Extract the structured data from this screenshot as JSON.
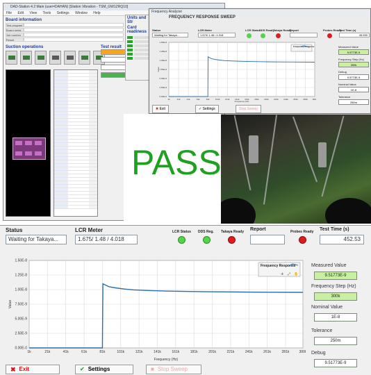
{
  "top": {
    "main_window_title": "DAD-Station 4.2 Main (user=DAHAN) [Station Vibration - TSM_GW1ZRQ10]",
    "menu": [
      "File",
      "Edit",
      "View",
      "Tools",
      "Settings",
      "Window",
      "Help"
    ],
    "board_info_title": "Board information",
    "board_info_rows": [
      {
        "key": "Test program",
        "value": ""
      },
      {
        "key": "Board serial",
        "value": ""
      },
      {
        "key": "Job number",
        "value": ""
      },
      {
        "key": "Result",
        "value": ""
      }
    ],
    "suction_title": "Suction operations",
    "right_strip_title": "Units and Str",
    "right_strip_sub": "Card readiness",
    "test_result_title": "Test result",
    "inset_window_title": "Frequency Analyzer",
    "inset_heading": "FREQUENCY RESPONSE SWEEP",
    "inset": {
      "status_label": "Status",
      "status_value": "Waiting for Takaya...",
      "lcr_label": "LCR Meter",
      "lcr_value": "1.670/ 1.48 / 4.018",
      "leds": [
        "LCR Status",
        "DDS Ready",
        "Takaya Ready"
      ],
      "report_label": "Report",
      "probes_label": "Probes Ready",
      "test_time_label": "Test Time (s)",
      "test_time_value": "45.530",
      "measured_label": "Measured Value",
      "measured_value": "9.5773E-9",
      "freq_step_label": "Frequency Step (Hz)",
      "freq_step_value": "300k",
      "debug_label": "Debug",
      "debug_value": "9.5773E-9",
      "nominal_label": "Nominal Value",
      "nominal_value": "1E-8",
      "tolerance_label": "Tolerance",
      "tolerance_value": "250m",
      "buttons": [
        "Exit",
        "Settings",
        "Stop Sweep"
      ]
    },
    "pass_text": "PASS"
  },
  "freq_app": {
    "status_label": "Status",
    "status_value": "Waiting for Takaya...",
    "lcr_label": "LCR Meter",
    "lcr_value": "1.675/ 1.48 / 4.018",
    "led_labels": [
      "LCR Status",
      "DDS Reg.",
      "Takaya Ready"
    ],
    "led_colors": [
      "#52d645",
      "#52d645",
      "#e01b1b"
    ],
    "report_label": "Report",
    "probes_label": "Probes Ready",
    "probes_color": "#e01b1b",
    "test_time_label": "Test Time (s)",
    "test_time_value": "452.53",
    "measured_label": "Measured Value",
    "measured_value": "9.51773E-9",
    "freq_step_label": "Frequency Step (Hz)",
    "freq_step_value": "300k",
    "nominal_label": "Nominal Value",
    "nominal_value": "1E-8",
    "tolerance_label": "Tolerance",
    "tolerance_value": "250m",
    "debug_label": "Debug",
    "debug_value": "9.51773E-9",
    "exit_label": "Exit",
    "settings_label": "Settings",
    "stop_label": "Stop Sweep",
    "legend_label": "Frequency Response"
  },
  "chart_data": {
    "type": "line",
    "title": "",
    "xlabel": "Frequency (Hz)",
    "ylabel": "Value",
    "xlim": [
      1000,
      300000
    ],
    "ylim": [
      0,
      1.5e-08
    ],
    "x_ticks": [
      "1k",
      "21k",
      "41k",
      "61k",
      "81k",
      "101k",
      "121k",
      "141k",
      "161k",
      "181k",
      "201k",
      "221k",
      "241k",
      "261k",
      "281k",
      "300k"
    ],
    "x_tick_values": [
      1000,
      21000,
      41000,
      61000,
      81000,
      101000,
      121000,
      141000,
      161000,
      181000,
      201000,
      221000,
      241000,
      261000,
      281000,
      300000
    ],
    "y_ticks": [
      "0.00E-0",
      "2.50E-9",
      "5.00E-9",
      "7.50E-9",
      "1.00E-8",
      "1.25E-8",
      "1.50E-8"
    ],
    "y_tick_values": [
      0,
      2.5e-09,
      5e-09,
      7.5e-09,
      1e-08,
      1.25e-08,
      1.5e-08
    ],
    "grid": true,
    "legend": "top-right",
    "series": [
      {
        "name": "Frequency Response",
        "color": "#2a6fa8",
        "x": [
          1000,
          81000,
          81500,
          84000,
          88000,
          95000,
          105000,
          115000,
          130000,
          150000,
          175000,
          200000,
          230000,
          260000,
          300000
        ],
        "y": [
          0,
          0,
          1.1e-08,
          1.08e-08,
          1.05e-08,
          1.03e-08,
          1.01e-08,
          9.95e-09,
          9.85e-09,
          9.75e-09,
          9.68e-09,
          9.62e-09,
          9.58e-09,
          9.55e-09,
          9.52e-09
        ]
      }
    ]
  }
}
